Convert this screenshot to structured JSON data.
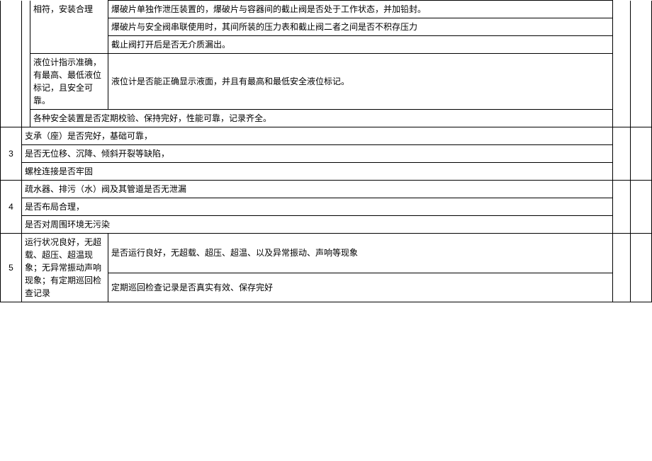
{
  "rows": {
    "topGroup": {
      "descA": "相符，安装合理",
      "detail1": "爆破片单独作泄压装置的，爆破片与容器间的截止阀是否处于工作状态，并加铅封。",
      "detail2": "爆破片与安全阀串联使用时，其间所装的压力表和截止阀二者之间是否不积存压力",
      "detail3": "截止阀打开后是否无介质漏出。",
      "descB": "液位计指示准确，有最高、最低液位标记，且安全可靠。",
      "detail4": "液位计是否能正确显示液面，并且有最高和最低安全液位标记。",
      "detail5": "各种安全装置是否定期校验、保持完好，性能可靠，记录齐全。"
    },
    "g3": {
      "num": "3",
      "line1": "支承（座）是否完好，基础可靠，",
      "line2": "是否无位移、沉降、倾斜开裂等缺陷，",
      "line3": "螺栓连接是否牢固"
    },
    "g4": {
      "num": "4",
      "line1": "疏水器、排污（水）阀及其管道是否无泄漏",
      "line2": "是否布局合理，",
      "line3": "是否对周围环境无污染"
    },
    "g5": {
      "num": "5",
      "desc": "运行状况良好，无超载、超压、超温现象；无异常振动声响现象；有定期巡回检查记录",
      "detail1": "是否运行良好，无超载、超压、超温、以及异常振动、声响等现象",
      "detail2": "定期巡回检查记录是否真实有效、保存完好"
    }
  }
}
